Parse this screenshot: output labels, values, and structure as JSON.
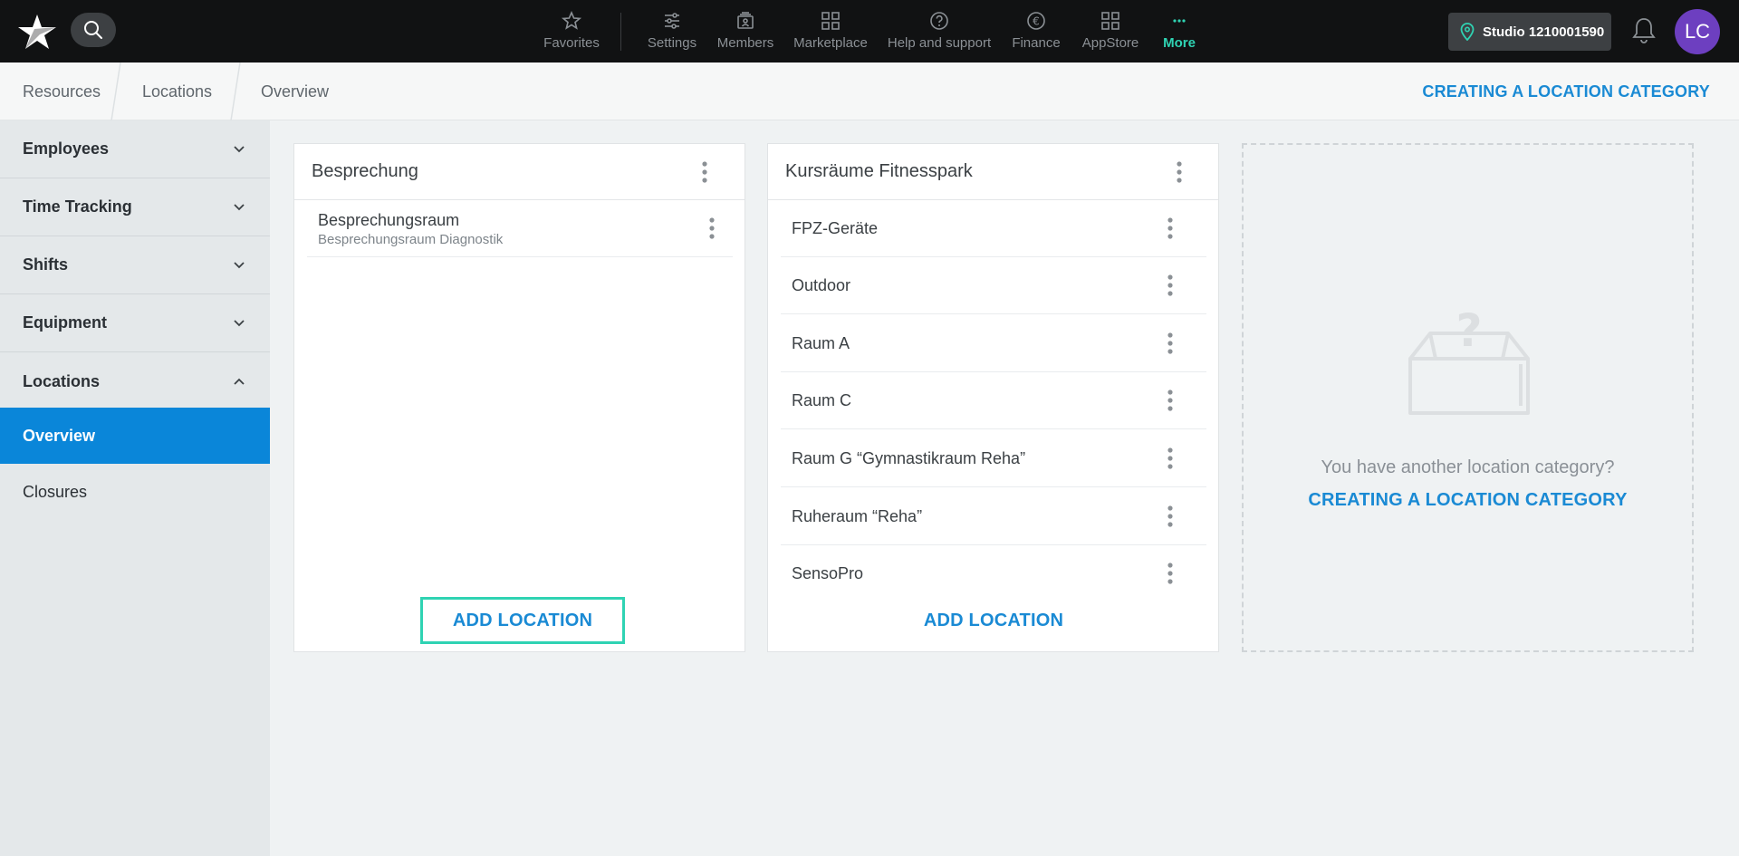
{
  "topbar": {
    "nav": [
      {
        "label": "Favorites",
        "icon": "star-icon"
      },
      {
        "label": "Settings",
        "icon": "sliders-icon"
      },
      {
        "label": "Members",
        "icon": "members-icon"
      },
      {
        "label": "Marketplace",
        "icon": "grid-icon"
      },
      {
        "label": "Help and support",
        "icon": "help-icon"
      },
      {
        "label": "Finance",
        "icon": "euro-icon"
      },
      {
        "label": "AppStore",
        "icon": "apps-icon"
      },
      {
        "label": "More",
        "icon": "more-icon"
      }
    ],
    "studio": "Studio 1210001590",
    "avatar": "LC"
  },
  "breadcrumb": {
    "items": [
      "Resources",
      "Locations",
      "Overview"
    ],
    "action": "CREATING A LOCATION CATEGORY"
  },
  "sidebar": {
    "items": [
      "Employees",
      "Time Tracking",
      "Shifts",
      "Equipment",
      "Locations"
    ],
    "subitems": [
      "Overview",
      "Closures"
    ]
  },
  "cards": [
    {
      "title": "Besprechung",
      "rows": [
        {
          "name": "Besprechungsraum",
          "sub": "Besprechungsraum Diagnostik"
        }
      ],
      "add_label": "ADD LOCATION"
    },
    {
      "title": "Kursräume Fitnesspark",
      "rows": [
        {
          "name": "FPZ-Geräte"
        },
        {
          "name": "Outdoor"
        },
        {
          "name": "Raum A"
        },
        {
          "name": "Raum C"
        },
        {
          "name": "Raum G “Gymnastikraum Reha”"
        },
        {
          "name": "Ruheraum “Reha”"
        },
        {
          "name": "SensoPro"
        }
      ],
      "add_label": "ADD LOCATION"
    }
  ],
  "empty": {
    "text": "You have another location category?",
    "action": "CREATING A LOCATION CATEGORY"
  },
  "colors": {
    "accent": "#1a8ad4",
    "active_nav": "#2fd3b3",
    "sidebar_active": "#0a86d9",
    "avatar": "#6d3fc0",
    "highlight": "#2fd3b3"
  }
}
